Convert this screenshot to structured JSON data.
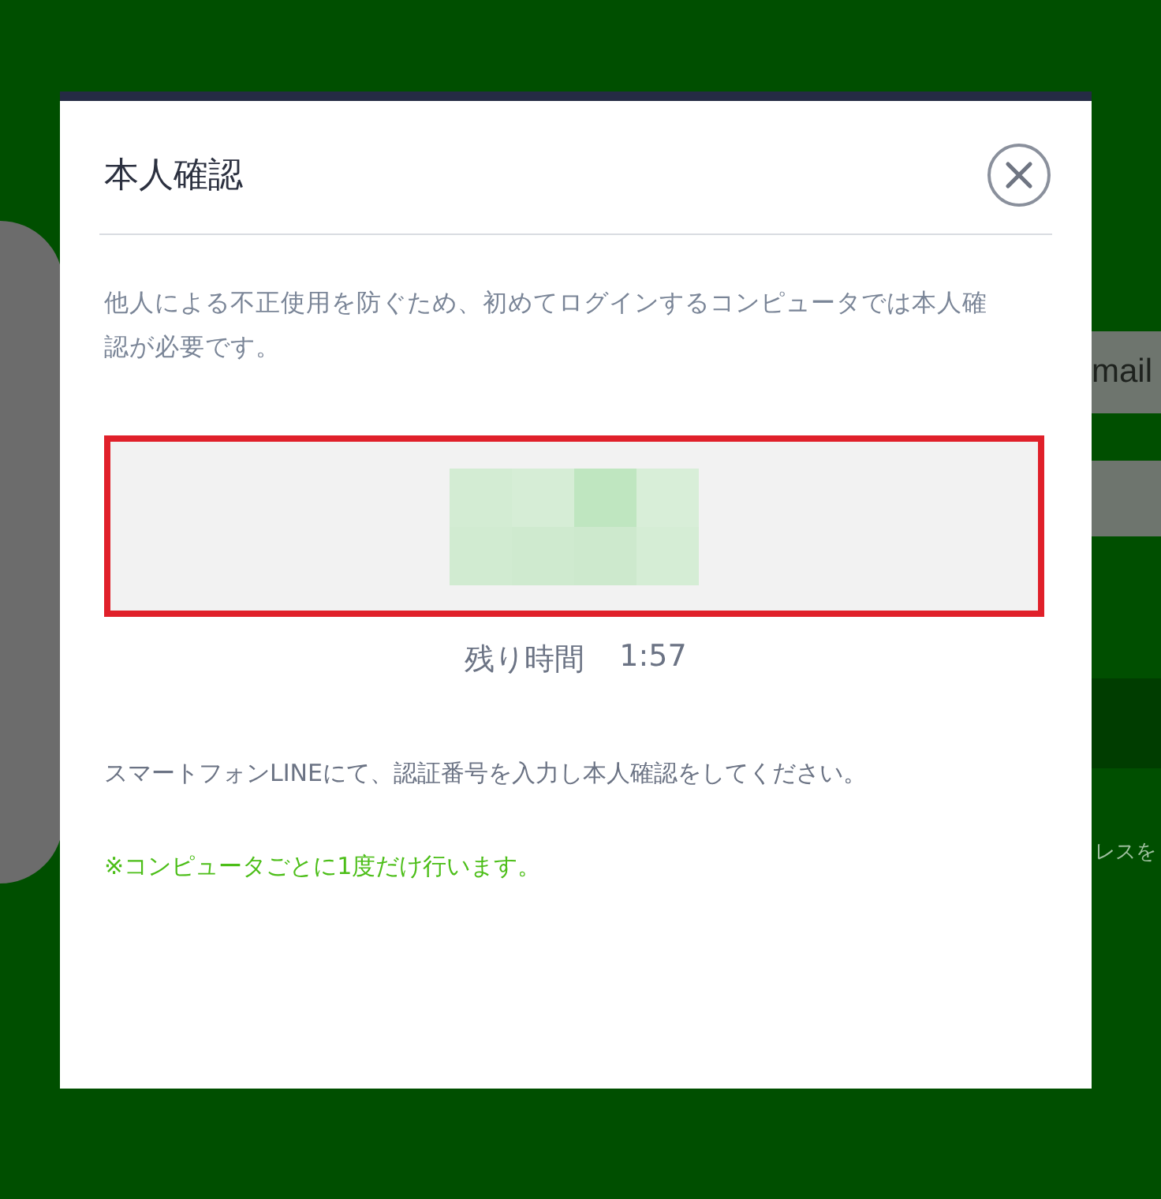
{
  "background": {
    "field_text": "mail",
    "hint_text": "レスを"
  },
  "dialog": {
    "title": "本人確認",
    "description": "他人による不正使用を防ぐため、初めてログインするコンピュータでは本人確認が必要です。",
    "timer": {
      "label": "残り時間",
      "value": "1:57"
    },
    "instruction": "スマートフォンLINEにて、認証番号を入力し本人確認をしてください。",
    "note": "※コンピュータごとに1度だけ行います。"
  }
}
